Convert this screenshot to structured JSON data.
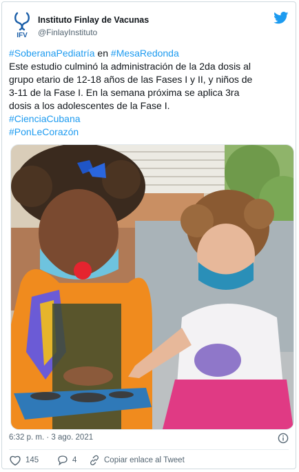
{
  "tweet": {
    "author_name": "Instituto Finlay de Vacunas",
    "handle": "@FinlayInstituto",
    "logo_text": "IFV",
    "text_lines": [
      [
        {
          "t": "#SoberanaPediatría",
          "tag": true
        },
        {
          "t": " en ",
          "tag": false
        },
        {
          "t": "#MesaRedonda",
          "tag": true
        }
      ],
      [
        {
          "t": "Este estudio culminó la administración de la 2da dosis al",
          "tag": false
        }
      ],
      [
        {
          "t": "grupo etario de 12-18 años de las Fases I y II, y niños de",
          "tag": false
        }
      ],
      [
        {
          "t": "3-11 de la Fase I. En la semana próxima se aplica 3ra",
          "tag": false
        }
      ],
      [
        {
          "t": "dosis a los adolescentes de la Fase I.",
          "tag": false
        }
      ],
      [
        {
          "t": "#CienciaCubana",
          "tag": true
        }
      ],
      [
        {
          "t": "#PonLeCorazón",
          "tag": true
        }
      ]
    ],
    "timestamp": "6:32 p. m. · 3 ago. 2021",
    "likes": "145",
    "replies": "4",
    "copy_link_label": "Copiar enlace al Tweet"
  },
  "icons": {
    "brand": "twitter-bird-icon",
    "info": "info-icon",
    "like": "heart-icon",
    "reply": "reply-icon",
    "link": "link-icon"
  },
  "colors": {
    "accent": "#1d9bf0",
    "logo_blue": "#1a5ea8",
    "secondary_text": "#536471"
  }
}
